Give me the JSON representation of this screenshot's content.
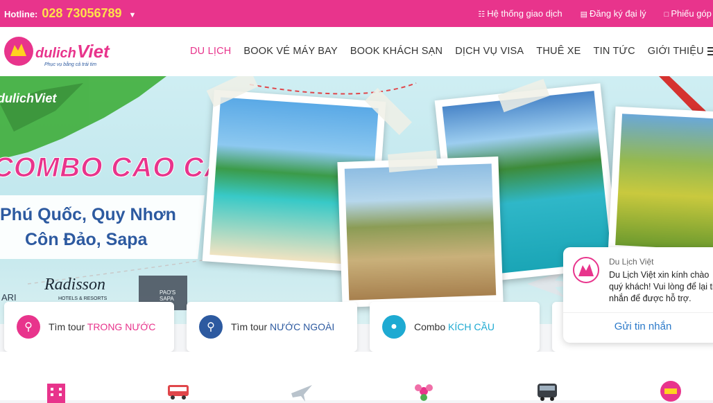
{
  "topbar": {
    "hotline_label": "Hotline:",
    "hotline_number": "028 73056789",
    "links": [
      {
        "icon": "sitemap-icon",
        "label": "Hệ thống giao dịch"
      },
      {
        "icon": "id-card-icon",
        "label": "Đăng ký đại lý"
      },
      {
        "icon": "document-icon",
        "label": "Phiếu góp ý"
      }
    ]
  },
  "header": {
    "logo_text": "dulichViet",
    "logo_tagline": "Phục vụ bằng cả trái tim",
    "nav": [
      "DU LỊCH",
      "BOOK VÉ MÁY BAY",
      "BOOK KHÁCH SẠN",
      "DỊCH VỤ VISA",
      "THUÊ XE",
      "TIN TỨC",
      "GIỚI THIỆU"
    ]
  },
  "banner": {
    "brand": "dulichViet",
    "headline": "COMBO CAO CẤP",
    "line1": "Phú Quốc, Quy Nhơn",
    "line2": "Côn Đảo, Sapa",
    "partners": [
      "ARI",
      "Radisson",
      "HOTELS & RESORTS",
      "PAO'S SAPA"
    ]
  },
  "search": [
    {
      "prefix": "Tìm tour ",
      "highlight": "TRONG NƯỚC",
      "color": "#e8348c",
      "icon": "search-icon"
    },
    {
      "prefix": "Tìm tour ",
      "highlight": "NƯỚC NGOÀI",
      "color": "#2d5aa0",
      "icon": "search-icon"
    },
    {
      "prefix": "Combo ",
      "highlight": "KÍCH CẦU",
      "color": "#1eaad2",
      "icon": "group-icon"
    }
  ],
  "chat": {
    "name": "Du Lịch Việt",
    "message": "Du Lịch Việt xin kính chào quý khách! Vui lòng để lại tin nhắn để được hỗ trợ.",
    "button": "Gửi tin nhắn"
  },
  "colors": {
    "brand": "#e8348c",
    "hotline": "#ffe14a",
    "link": "#2a79c9"
  }
}
